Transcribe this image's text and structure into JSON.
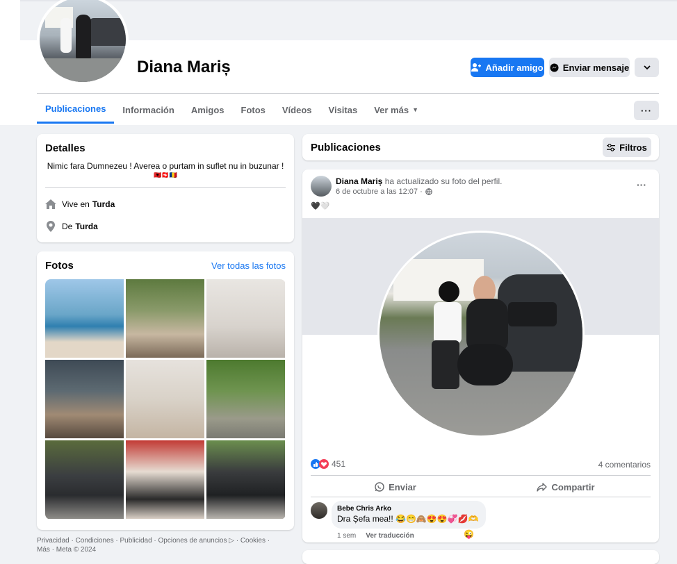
{
  "profile": {
    "name": "Diana Mariș"
  },
  "actions": {
    "add_friend": "Añadir amigo",
    "message": "Enviar mensaje"
  },
  "tabs": [
    "Publicaciones",
    "Información",
    "Amigos",
    "Fotos",
    "Vídeos",
    "Visitas",
    "Ver más"
  ],
  "details": {
    "title": "Detalles",
    "bio": "Nimic fara Dumnezeu ! Averea o purtam in suflet nu in buzunar !",
    "bio_emojis": "🇦🇱🇨🇭🇷🇴",
    "lives_prefix": "Vive en",
    "lives_city": "Turda",
    "from_prefix": "De",
    "from_city": "Turda"
  },
  "photos": {
    "title": "Fotos",
    "see_all": "Ver todas las fotos"
  },
  "footer": {
    "line1": "Privacidad · Condiciones · Publicidad · Opciones de anuncios ▷ · Cookies ·",
    "line2": "Más · Meta © 2024"
  },
  "posts": {
    "title": "Publicaciones",
    "filters": "Filtros"
  },
  "post": {
    "author": "Diana Mariș",
    "action": "ha actualizado su foto del perfil.",
    "time": "6 de octubre a las 12:07 ·",
    "emoji": "🖤🤍",
    "reactions_count": "451",
    "comments_count": "4 comentarios",
    "send": "Enviar",
    "share": "Compartir"
  },
  "comment": {
    "author": "Bebe Chris Arko",
    "text": "Dra Șefa mea!! 😂😁🙈😍😍💞💋🫶",
    "age": "1 sem",
    "translate": "Ver traducción",
    "reaction": "😜"
  }
}
